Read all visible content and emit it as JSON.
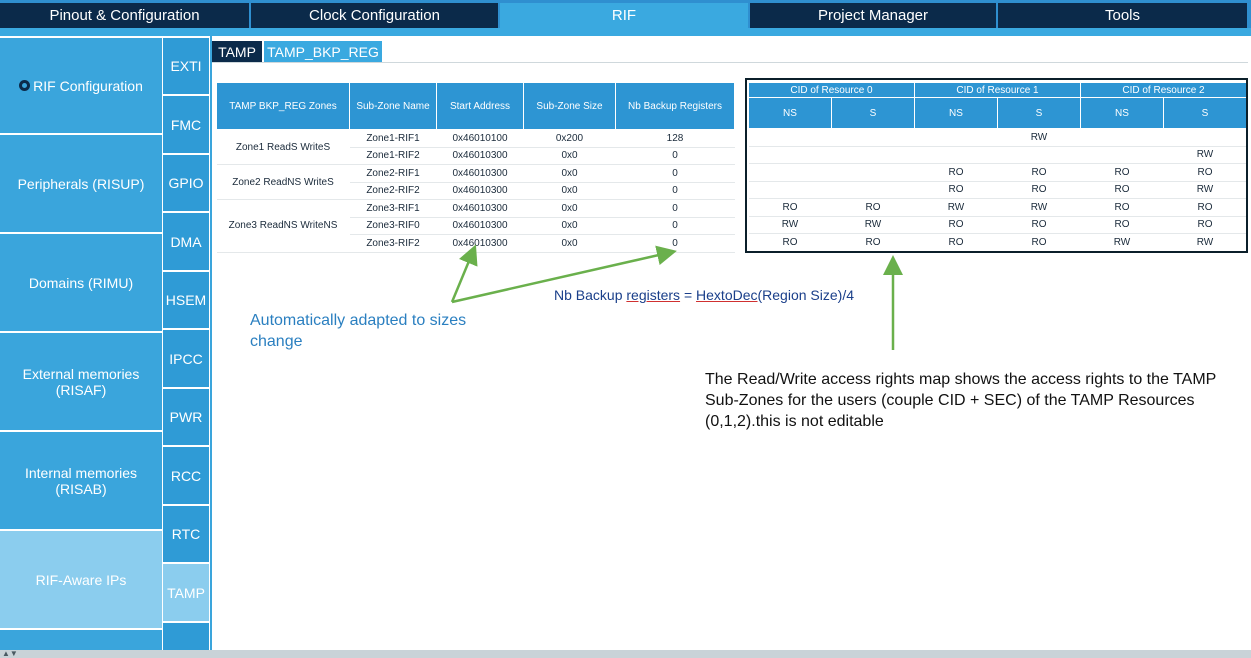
{
  "topnav": {
    "tabs": [
      "Pinout & Configuration",
      "Clock Configuration",
      "RIF",
      "Project Manager",
      "Tools"
    ],
    "active": "RIF"
  },
  "sidebar": {
    "items": [
      "RIF Configuration",
      "Peripherals (RISUP)",
      "Domains (RIMU)",
      "External memories (RISAF)",
      "Internal memories (RISAB)",
      "RIF-Aware IPs"
    ],
    "active": "RIF-Aware IPs"
  },
  "peripherals": {
    "items": [
      "EXTI",
      "FMC",
      "GPIO",
      "DMA",
      "HSEM",
      "IPCC",
      "PWR",
      "RCC",
      "RTC",
      "TAMP"
    ],
    "active": "TAMP"
  },
  "subtabs": {
    "items": [
      "TAMP",
      "TAMP_BKP_REG"
    ],
    "active": "TAMP_BKP_REG"
  },
  "zone_table": {
    "headers": [
      "TAMP BKP_REG Zones",
      "Sub-Zone Name",
      "Start Address",
      "Sub-Zone Size",
      "Nb Backup Registers"
    ],
    "zones": [
      "Zone1 ReadS WriteS",
      "Zone2 ReadNS WriteS",
      "Zone3 ReadNS WriteNS"
    ],
    "rows": [
      [
        "Zone1-RIF1",
        "0x46010100",
        "0x200",
        "128"
      ],
      [
        "Zone1-RIF2",
        "0x46010300",
        "0x0",
        "0"
      ],
      [
        "Zone2-RIF1",
        "0x46010300",
        "0x0",
        "0"
      ],
      [
        "Zone2-RIF2",
        "0x46010300",
        "0x0",
        "0"
      ],
      [
        "Zone3-RIF1",
        "0x46010300",
        "0x0",
        "0"
      ],
      [
        "Zone3-RIF0",
        "0x46010300",
        "0x0",
        "0"
      ],
      [
        "Zone3-RIF2",
        "0x46010300",
        "0x0",
        "0"
      ]
    ]
  },
  "cid_table": {
    "groups": [
      "CID of Resource 0",
      "CID of Resource 1",
      "CID of Resource 2"
    ],
    "sub_headers": [
      "NS",
      "S",
      "NS",
      "S",
      "NS",
      "S"
    ],
    "rows": [
      [
        "",
        "",
        "",
        "RW",
        "",
        ""
      ],
      [
        "",
        "",
        "",
        "",
        "",
        "RW"
      ],
      [
        "",
        "",
        "RO",
        "RO",
        "RO",
        "RO"
      ],
      [
        "",
        "",
        "RO",
        "RO",
        "RO",
        "RW"
      ],
      [
        "RO",
        "RO",
        "RW",
        "RW",
        "RO",
        "RO"
      ],
      [
        "RW",
        "RW",
        "RO",
        "RO",
        "RO",
        "RO"
      ],
      [
        "RO",
        "RO",
        "RO",
        "RO",
        "RW",
        "RW"
      ]
    ]
  },
  "annotations": {
    "left": "Automatically adapted to sizes change",
    "mid_prefix": "Nb Backup ",
    "mid_underlined_1": "registers",
    "mid_eq": " = ",
    "mid_underlined_2": "HextoDec",
    "mid_suffix": "(Region Size)/4",
    "right": "The Read/Write access rights map shows the access rights to the TAMP Sub-Zones for the users (couple CID + SEC) of the TAMP Resources (0,1,2).this is not editable"
  },
  "colors": {
    "nav_dark": "#0b2a4a",
    "accent": "#3aa9e0",
    "header_blue": "#2d95d3",
    "arrow_green": "#6ab04c"
  }
}
